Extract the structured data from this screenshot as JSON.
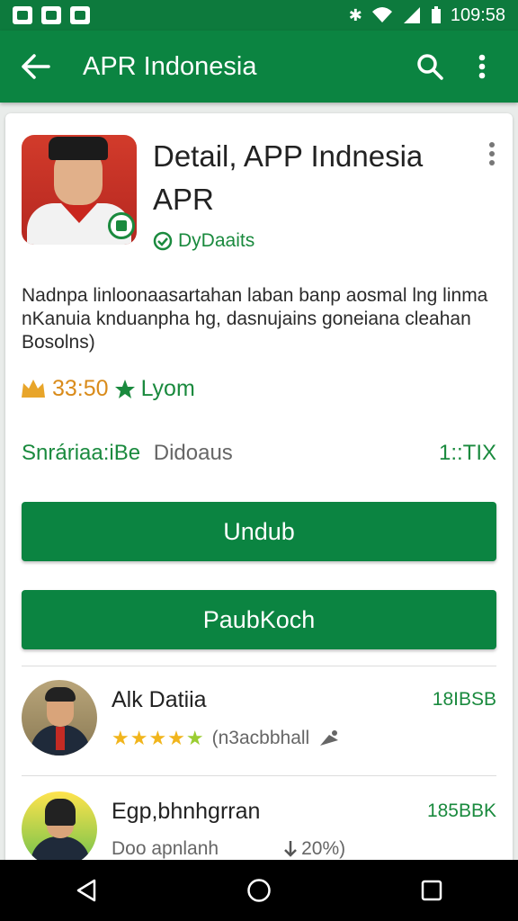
{
  "status_bar": {
    "time": "109:58",
    "icons": [
      "notification-n-icon",
      "notification-app-icon",
      "notification-media-icon",
      "bluetooth-icon",
      "wifi-icon",
      "signal-icon",
      "battery-icon"
    ]
  },
  "app_bar": {
    "title": "APR Indonesia",
    "icons": [
      "back-arrow-icon",
      "search-icon",
      "more-vert-icon"
    ]
  },
  "app_detail": {
    "title": "Detail, APP Indnesia APR",
    "developer": "DyDaaits",
    "description": "Nadnpa linloonaasartahan laban banp aosmal lng linma nKanuia knduanpha hg, dasnujains goneiana cleahan Bosolns)",
    "rating_value": "33:50",
    "rating_label": "Lyom",
    "info_left_1": "Snráriaa:iBe",
    "info_left_2": "Didoaus",
    "info_right": "1::TIX"
  },
  "buttons": {
    "primary": "Undub",
    "secondary": "PaubKoch"
  },
  "list": [
    {
      "name": "Alk Datiia",
      "size": "18IBSB",
      "sub_text": "(n3acbbhall",
      "rating_stars": 4.5
    },
    {
      "name": "Egp,bhnhgrran",
      "size": "185BBK",
      "sub_left": "Doo apnlanh",
      "sub_right": "20%)"
    }
  ],
  "colors": {
    "status_bar": "#0d7a3d",
    "app_bar": "#0b8441",
    "accent": "#1a8a3e",
    "rating": "#d98b1a"
  }
}
